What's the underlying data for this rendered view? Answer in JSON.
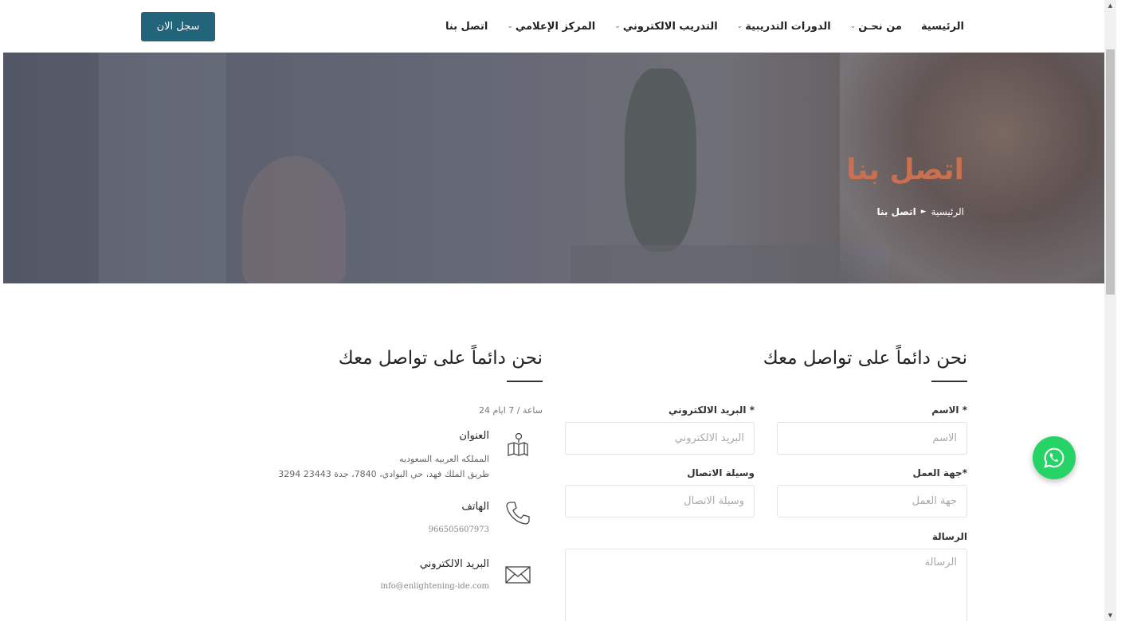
{
  "header": {
    "nav": [
      {
        "label": "الرئيسية",
        "dropdown": false
      },
      {
        "label": "من نحـن",
        "dropdown": true
      },
      {
        "label": "الدورات التدريبية",
        "dropdown": true
      },
      {
        "label": "التدريب الالكتروني",
        "dropdown": true
      },
      {
        "label": "المركز الإعلامي",
        "dropdown": true
      },
      {
        "label": "اتصل بنا",
        "dropdown": false
      }
    ],
    "register_label": "سجل الان"
  },
  "hero": {
    "title": "اتصل بنا",
    "breadcrumb": {
      "home": "الرئيسية",
      "separator": "►",
      "current": "اتصل بنا"
    }
  },
  "form": {
    "title": "نحن دائماً على تواصل معك",
    "name": {
      "label": "الاسم *",
      "placeholder": "الاسم"
    },
    "email": {
      "label": "البريد الالكتروني *",
      "placeholder": "البريد الالكتروني"
    },
    "employer": {
      "label": "جهة العمل*",
      "placeholder": "جهة العمل"
    },
    "contact_method": {
      "label": "وسيلة الاتصال",
      "placeholder": "وسيلة الاتصال"
    },
    "message": {
      "label": "الرسالة",
      "placeholder": "الرسالة"
    }
  },
  "info": {
    "title": "نحن دائماً على تواصل معك",
    "hours": "24 ساعة / 7 ايام",
    "address": {
      "heading": "العنوان",
      "line1": "المملكه العربيه السعوديه",
      "line2": "3294 طريق الملك فهد، حي البوادي، 7840، جدة 23443"
    },
    "phone": {
      "heading": "الهاتف",
      "value": "966505607973"
    },
    "email": {
      "heading": "البريد الالكتروني",
      "value": "info@enlightening-ide.com"
    }
  },
  "icons": {
    "address": "map-icon",
    "phone": "phone-icon",
    "email": "envelope-icon",
    "whatsapp": "whatsapp-icon"
  },
  "colors": {
    "brand": "#22647a",
    "hero_title": "#c8704f",
    "whatsapp": "#25d366"
  }
}
